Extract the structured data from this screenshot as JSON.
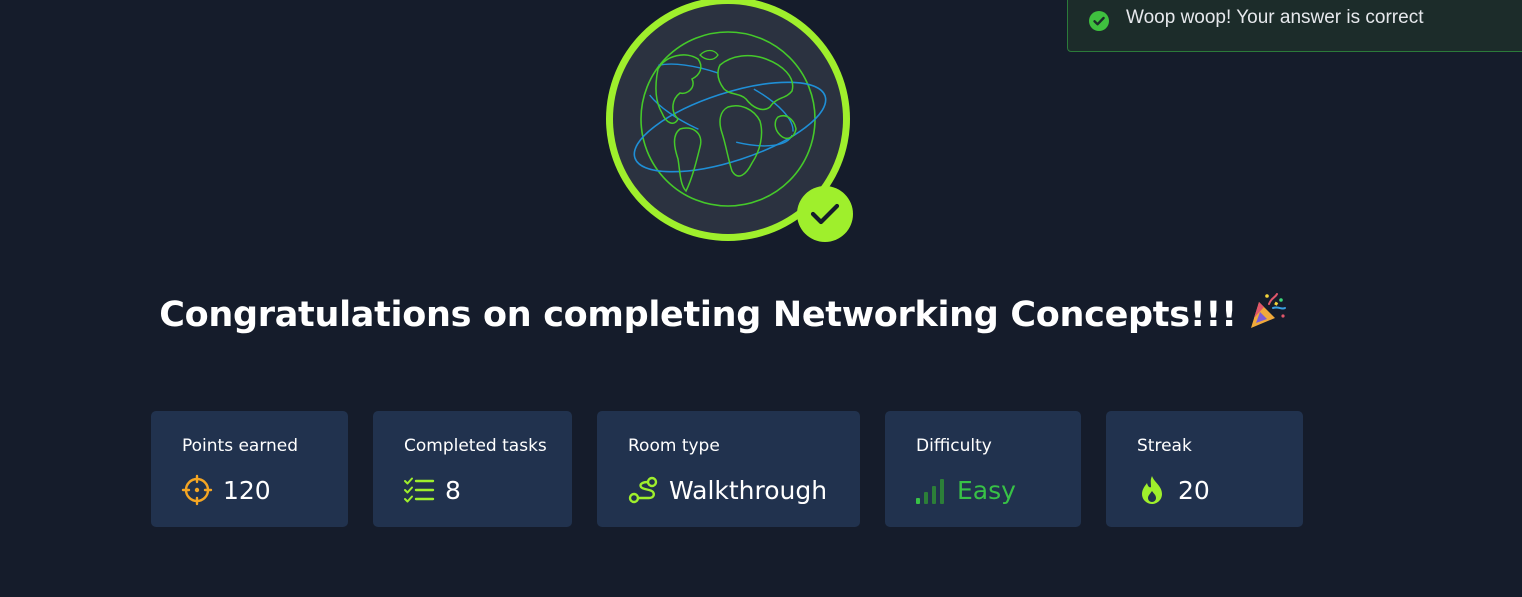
{
  "toast": {
    "message": "Woop woop! Your answer is correct",
    "icon": "check-circle-icon",
    "accent_color": "#3fc03f"
  },
  "badge": {
    "icon": "globe-icon",
    "ring_color": "#9fef2c",
    "status_icon": "check-icon"
  },
  "headline": {
    "text": "Congratulations on completing Networking Concepts!!!",
    "emoji": "party-popper-icon"
  },
  "stats": [
    {
      "label": "Points earned",
      "value": "120",
      "icon": "crosshair-icon",
      "icon_color": "#f5a623"
    },
    {
      "label": "Completed tasks",
      "value": "8",
      "icon": "task-list-icon",
      "icon_color": "#9fef2c"
    },
    {
      "label": "Room type",
      "value": "Walkthrough",
      "icon": "route-icon",
      "icon_color": "#9fef2c"
    },
    {
      "label": "Difficulty",
      "value": "Easy",
      "icon": "signal-bars-icon",
      "icon_color": "#38c246"
    },
    {
      "label": "Streak",
      "value": "20",
      "icon": "flame-icon",
      "icon_color": "#9fef2c"
    }
  ],
  "colors": {
    "background": "#151c2b",
    "card": "#21324e",
    "accent_green": "#9fef2c"
  }
}
